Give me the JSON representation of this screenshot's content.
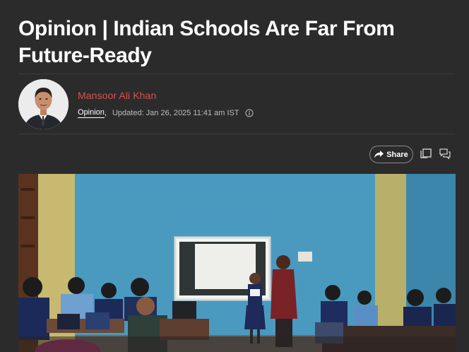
{
  "article": {
    "headline": "Opinion | Indian Schools Are Far From Future-Ready",
    "author": "Mansoor Ali Khan",
    "section": "Opinion",
    "comma": ",",
    "updated": "Updated: Jan 26, 2025 11:41 am IST"
  },
  "actions": {
    "share_label": "Share"
  },
  "icons": {
    "info": "info-icon",
    "share": "share-arrow-icon",
    "copy": "copy-icon",
    "comment": "comment-icon"
  },
  "colors": {
    "background": "#2b2b2b",
    "author": "#d9534f",
    "headline": "#ffffff",
    "meta": "#bdbdbd"
  }
}
